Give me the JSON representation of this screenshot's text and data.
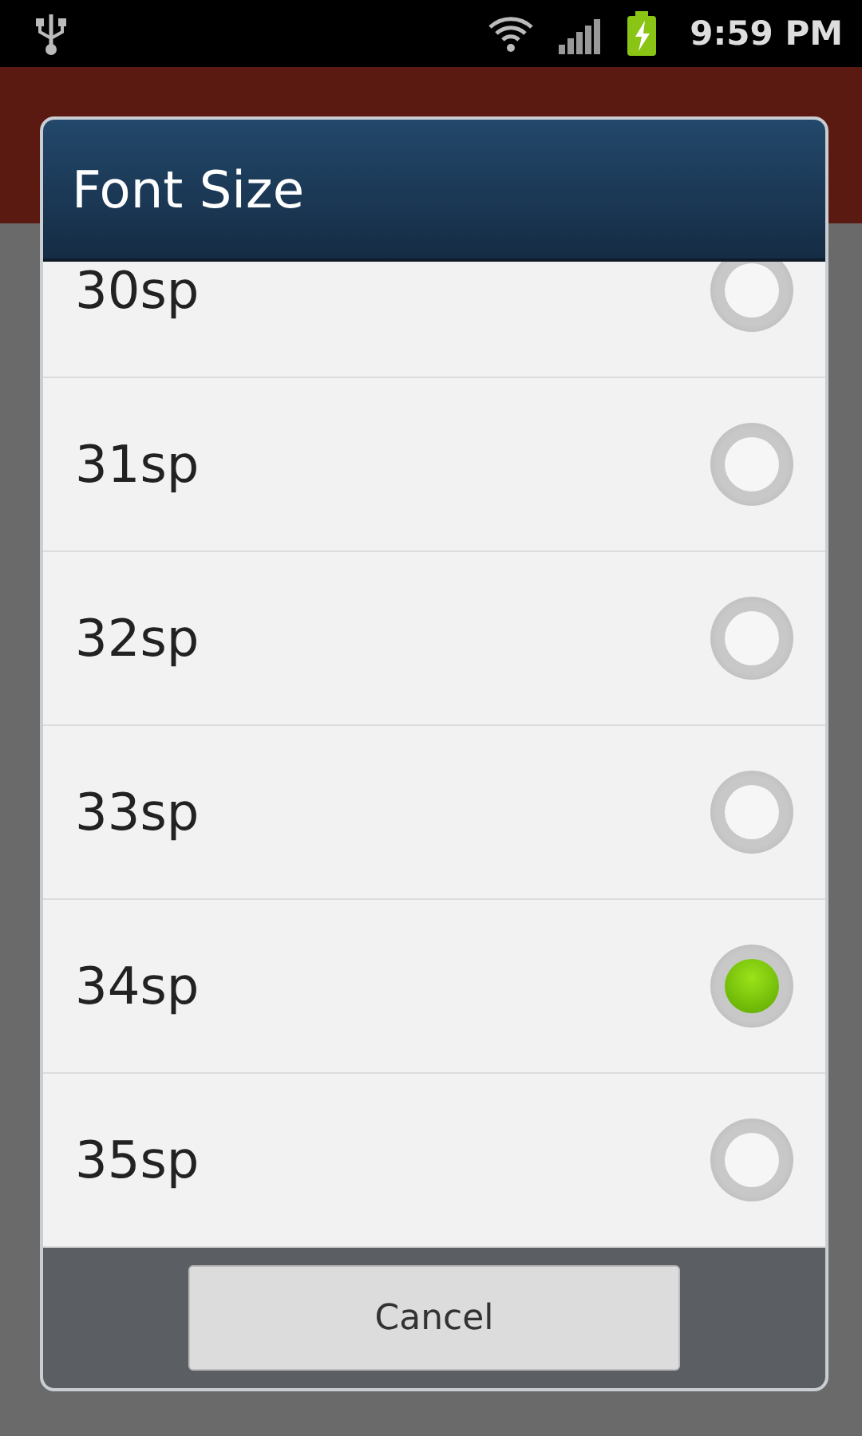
{
  "status_bar": {
    "time": "9:59 PM"
  },
  "dialog": {
    "title": "Font Size",
    "options": [
      {
        "label": "30sp",
        "selected": false
      },
      {
        "label": "31sp",
        "selected": false
      },
      {
        "label": "32sp",
        "selected": false
      },
      {
        "label": "33sp",
        "selected": false
      },
      {
        "label": "34sp",
        "selected": true
      },
      {
        "label": "35sp",
        "selected": false
      }
    ],
    "buttons": [
      "Cancel"
    ]
  }
}
